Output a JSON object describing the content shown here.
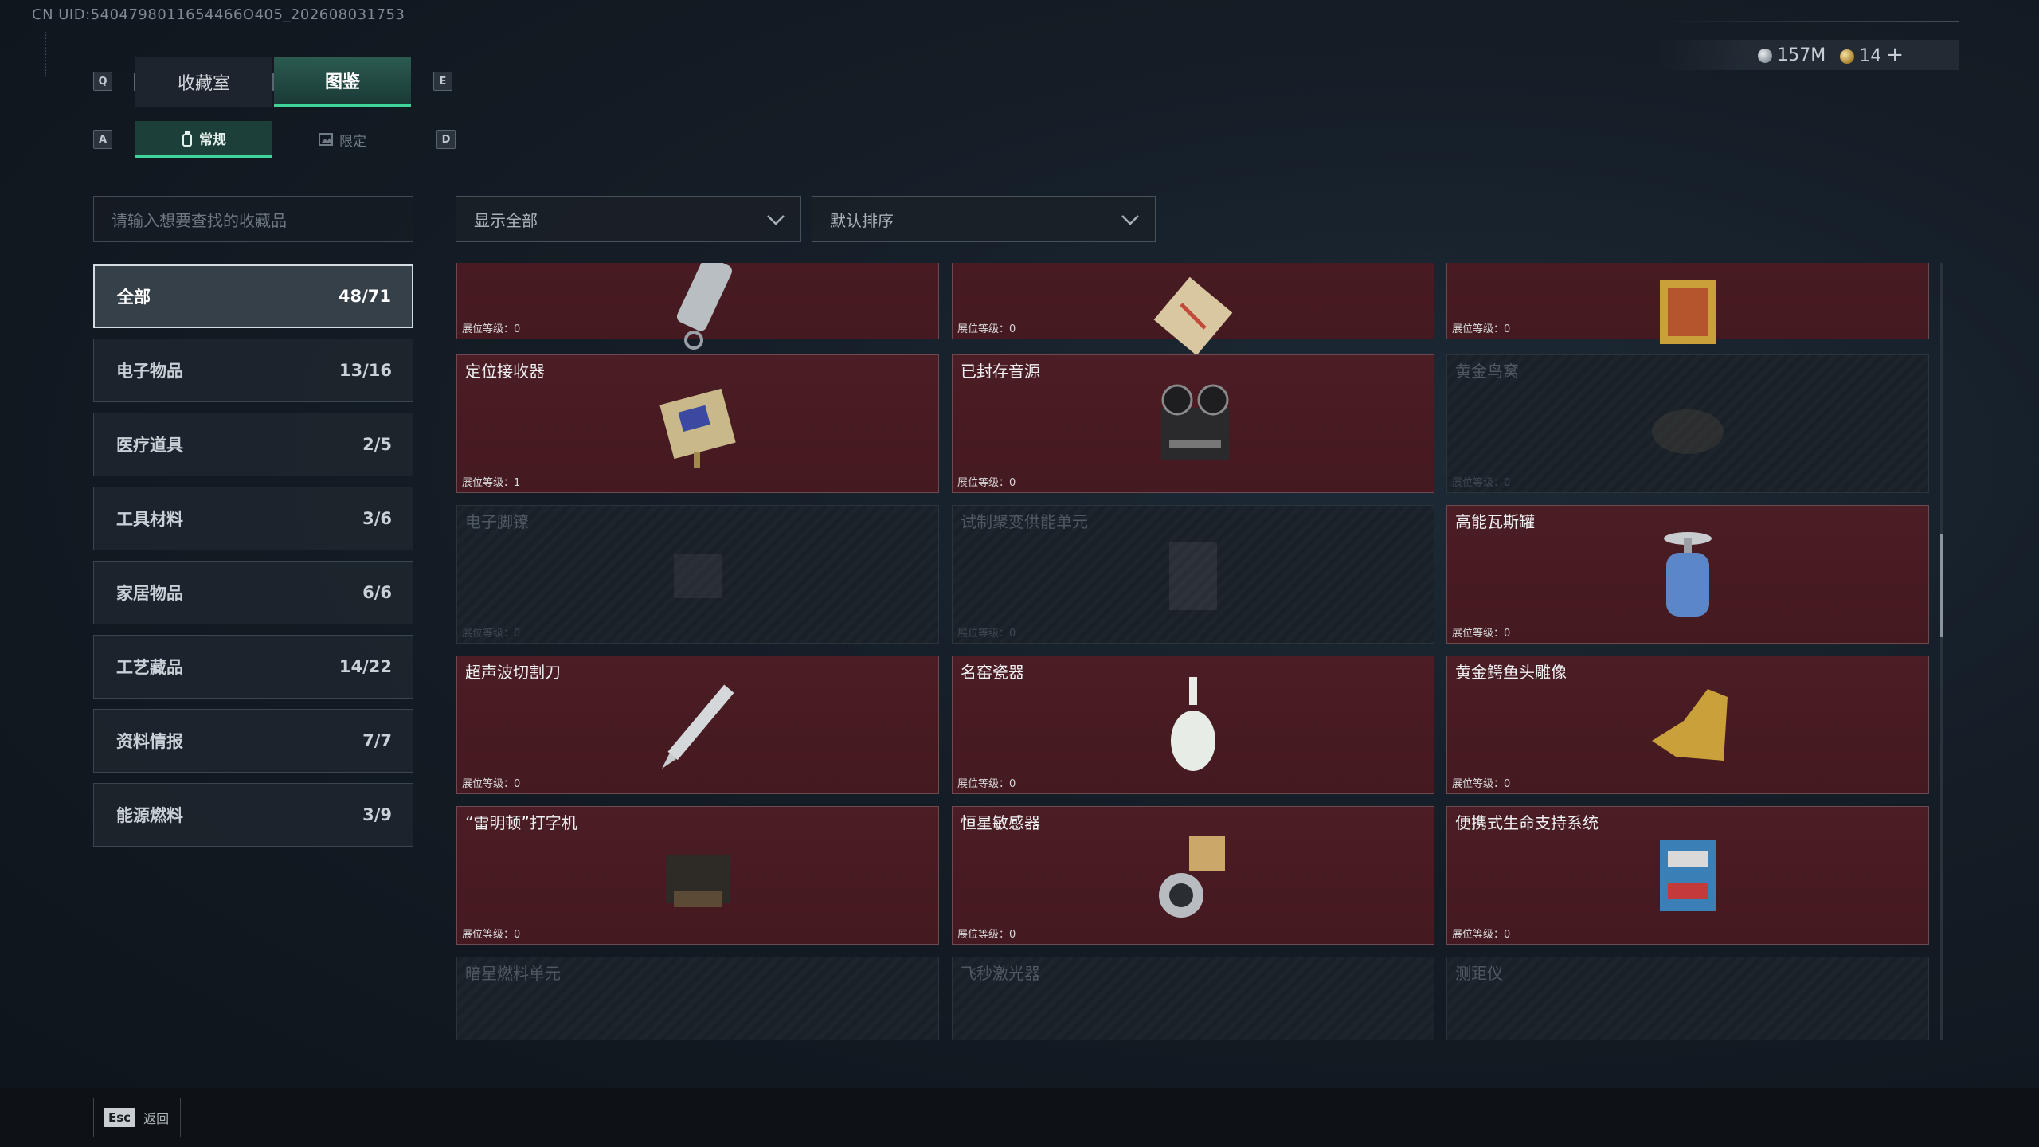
{
  "uid_text": "CN UID:5404798011654466O405_202608031753",
  "tabs": {
    "main": [
      {
        "key": "Q"
      },
      {
        "label": "收藏室"
      },
      {
        "label": "图鉴"
      },
      {
        "key": "E"
      }
    ],
    "main_left_key": "Q",
    "main_right_key": "E",
    "collection_label": "收藏室",
    "codex_label": "图鉴",
    "sub_left_key": "A",
    "sub_right_key": "D",
    "regular_label": "常规",
    "limited_label": "限定"
  },
  "currency": {
    "silver": "157M",
    "gold": "14",
    "plus": "+"
  },
  "search": {
    "placeholder": "请输入想要查找的收藏品"
  },
  "filters": {
    "show": "显示全部",
    "sort": "默认排序"
  },
  "categories": [
    {
      "label": "全部",
      "count": "48/71",
      "active": true
    },
    {
      "label": "电子物品",
      "count": "13/16"
    },
    {
      "label": "医疗道具",
      "count": "2/5"
    },
    {
      "label": "工具材料",
      "count": "3/6"
    },
    {
      "label": "家居物品",
      "count": "6/6"
    },
    {
      "label": "工艺藏品",
      "count": "14/22"
    },
    {
      "label": "资料情报",
      "count": "7/7"
    },
    {
      "label": "能源燃料",
      "count": "3/9"
    }
  ],
  "items": [
    {
      "name": "",
      "level": "展位等级：0",
      "locked": false,
      "icon": "flashlight-icon"
    },
    {
      "name": "",
      "level": "展位等级：0",
      "locked": false,
      "icon": "artwork-icon"
    },
    {
      "name": "",
      "level": "展位等级：0",
      "locked": false,
      "icon": "painting-icon"
    },
    {
      "name": "定位接收器",
      "level": "展位等级：1",
      "locked": false,
      "icon": "receiver-icon"
    },
    {
      "name": "已封存音源",
      "level": "展位等级：0",
      "locked": false,
      "icon": "tape-recorder-icon"
    },
    {
      "name": "黄金鸟窝",
      "level": "展位等级：0",
      "locked": true,
      "icon": "nest-icon"
    },
    {
      "name": "电子脚镣",
      "level": "展位等级：0",
      "locked": true,
      "icon": "anklet-icon"
    },
    {
      "name": "试制聚变供能单元",
      "level": "展位等级：0",
      "locked": true,
      "icon": "fusion-unit-icon"
    },
    {
      "name": "高能瓦斯罐",
      "level": "展位等级：0",
      "locked": false,
      "icon": "gas-canister-icon"
    },
    {
      "name": "超声波切割刀",
      "level": "展位等级：0",
      "locked": false,
      "icon": "cutter-icon"
    },
    {
      "name": "名窑瓷器",
      "level": "展位等级：0",
      "locked": false,
      "icon": "porcelain-vase-icon"
    },
    {
      "name": "黄金鳄鱼头雕像",
      "level": "展位等级：0",
      "locked": false,
      "icon": "gold-crocodile-icon"
    },
    {
      "name": "“雷明顿”打字机",
      "level": "展位等级：0",
      "locked": false,
      "icon": "typewriter-icon"
    },
    {
      "name": "恒星敏感器",
      "level": "展位等级：0",
      "locked": false,
      "icon": "star-sensor-icon"
    },
    {
      "name": "便携式生命支持系统",
      "level": "展位等级：0",
      "locked": false,
      "icon": "life-support-icon"
    },
    {
      "name": "暗星燃料单元",
      "level": "",
      "locked": true,
      "icon": "fuel-unit-icon"
    },
    {
      "name": "飞秒激光器",
      "level": "",
      "locked": true,
      "icon": "laser-icon"
    },
    {
      "name": "测距仪",
      "level": "",
      "locked": true,
      "icon": "rangefinder-icon"
    }
  ],
  "footer": {
    "esc_key": "Esc",
    "back_label": "返回"
  }
}
